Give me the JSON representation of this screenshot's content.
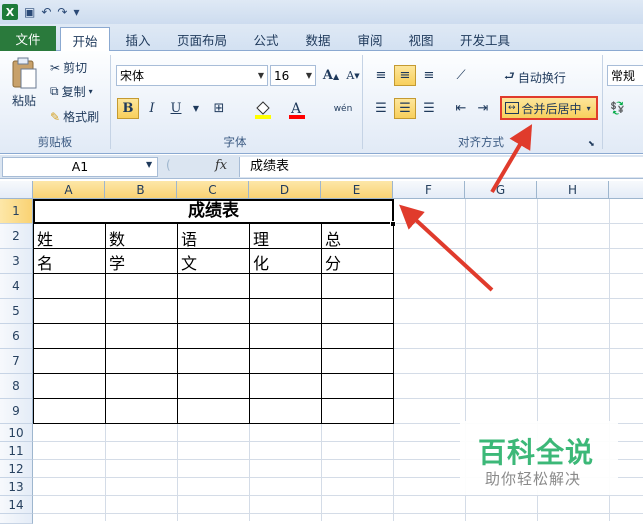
{
  "qat": {
    "app_icon": "X",
    "undo": "↶",
    "redo": "↷",
    "customize": "▾"
  },
  "tabs": [
    {
      "label": "文件"
    },
    {
      "label": "开始"
    },
    {
      "label": "插入"
    },
    {
      "label": "页面布局"
    },
    {
      "label": "公式"
    },
    {
      "label": "数据"
    },
    {
      "label": "审阅"
    },
    {
      "label": "视图"
    },
    {
      "label": "开发工具"
    }
  ],
  "clipboard": {
    "paste": "粘贴",
    "cut": "剪切",
    "copy": "复制",
    "format_painter": "格式刷",
    "group": "剪贴板"
  },
  "font": {
    "name": "宋体",
    "size": "16",
    "bold": "B",
    "italic": "I",
    "underline": "U",
    "group": "字体",
    "grow": "A",
    "shrink": "A",
    "phonetic": "wén",
    "fill_color": "#ffff00",
    "font_color": "#ff0000"
  },
  "alignment": {
    "wrap": "自动换行",
    "merge": "合并后居中",
    "group": "对齐方式"
  },
  "number": {
    "format": "常规"
  },
  "formula_bar": {
    "name_box": "A1",
    "fx": "fx",
    "value": "成绩表"
  },
  "columns": [
    "A",
    "B",
    "C",
    "D",
    "E",
    "F",
    "G",
    "H"
  ],
  "rows": [
    "1",
    "2",
    "3",
    "4",
    "5",
    "6",
    "7",
    "8",
    "9",
    "10",
    "11",
    "12",
    "13",
    "14"
  ],
  "table": {
    "title": "成绩表",
    "headers": [
      "姓名",
      "数学",
      "语文",
      "理化",
      "总分"
    ]
  },
  "watermark": {
    "title": "百科全说",
    "subtitle": "助你轻松解决"
  },
  "colors": {
    "file_tab": "#2a7a3c",
    "highlight": "#f8cf5c",
    "annotation": "#e03b2c"
  }
}
